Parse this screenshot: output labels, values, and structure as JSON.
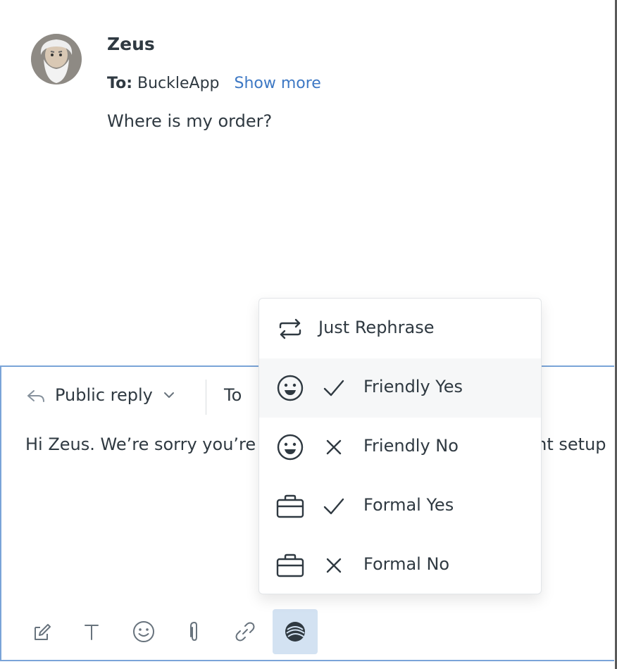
{
  "message": {
    "sender": "Zeus",
    "to_prefix": "To:",
    "to_value": "BuckleApp",
    "show_more": "Show more",
    "body": "Where is my order?",
    "avatar_icon": "zeus-avatar"
  },
  "composer": {
    "reply_type": "Public reply",
    "to_label": "To",
    "draft_text": "Hi Zeus. We’re sorry you’re",
    "draft_tail": "nt setup",
    "toolbar": [
      {
        "name": "compose-icon"
      },
      {
        "name": "text-format-icon"
      },
      {
        "name": "emoji-icon"
      },
      {
        "name": "attachment-icon"
      },
      {
        "name": "link-icon"
      },
      {
        "name": "ai-tone-icon",
        "active": true
      }
    ]
  },
  "menu": {
    "items": [
      {
        "label": "Just Rephrase",
        "icon": "rephrase-icon"
      },
      {
        "label": "Friendly Yes",
        "icon": "smile-icon",
        "mark": "check-icon"
      },
      {
        "label": "Friendly No",
        "icon": "smile-icon",
        "mark": "x-icon"
      },
      {
        "label": "Formal Yes",
        "icon": "briefcase-icon",
        "mark": "check-icon"
      },
      {
        "label": "Formal No",
        "icon": "briefcase-icon",
        "mark": "x-icon"
      }
    ]
  },
  "colors": {
    "text": "#2f3941",
    "link": "#3d78c4",
    "composer_border": "#7aa4d8",
    "active_button": "#d3e2f2"
  }
}
